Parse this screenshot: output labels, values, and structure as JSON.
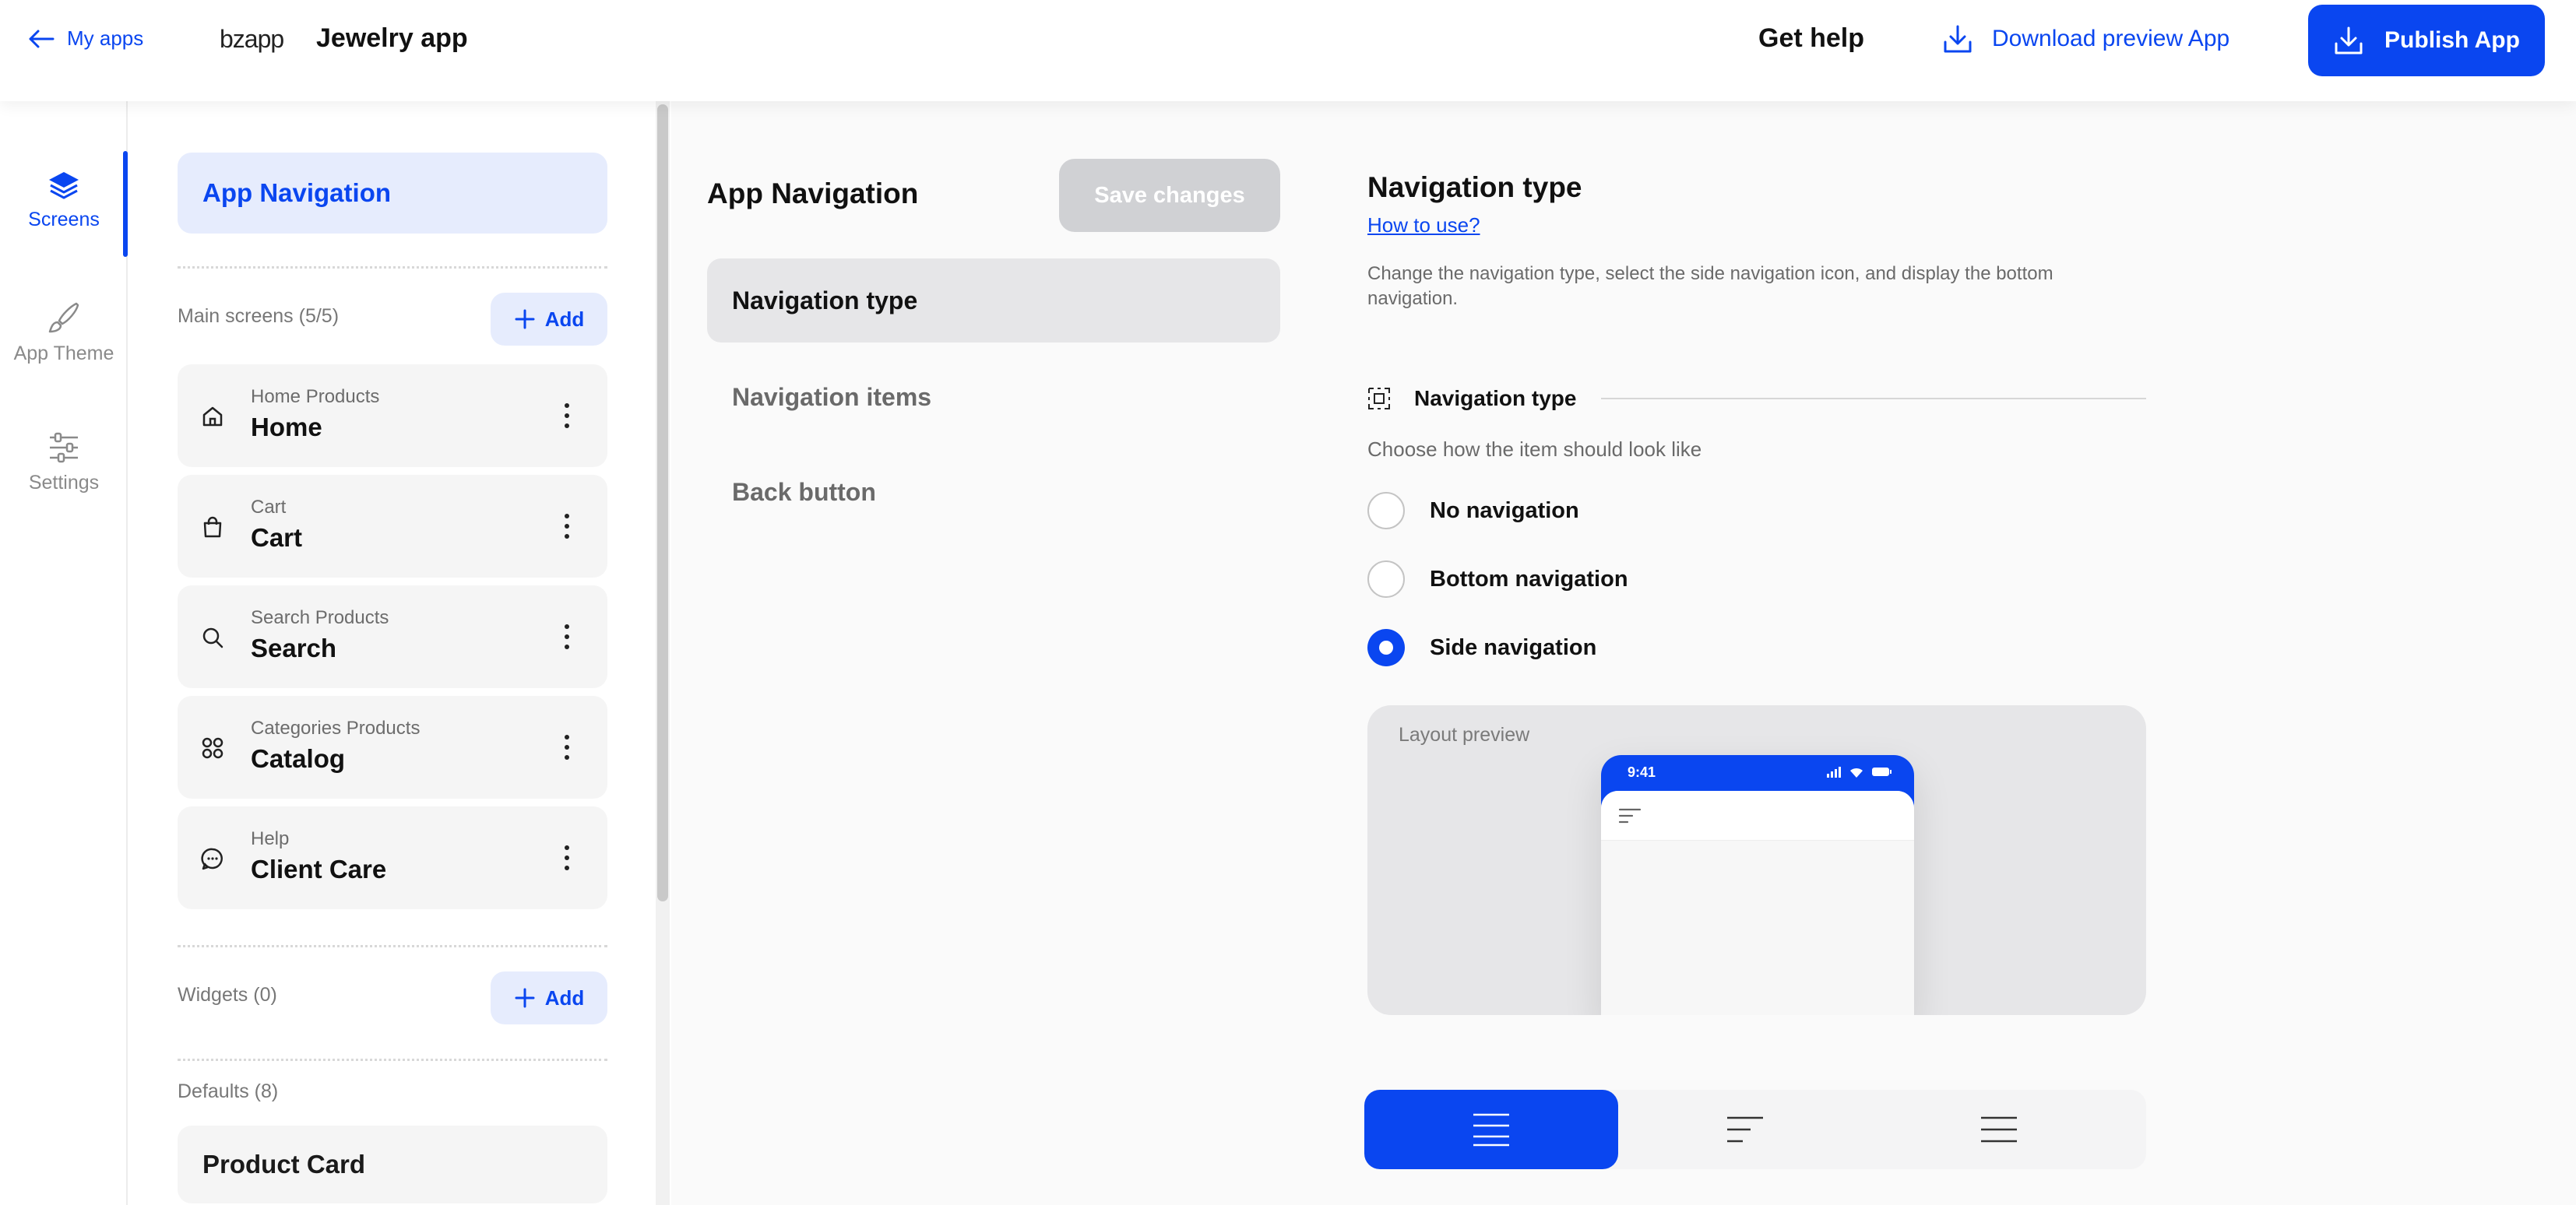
{
  "topbar": {
    "back_label": "My apps",
    "logo": "bzapp",
    "app_name": "Jewelry app",
    "get_help": "Get help",
    "download_label": "Download preview App",
    "publish_label": "Publish App"
  },
  "rail": {
    "items": [
      {
        "label": "Screens",
        "icon": "layers-icon",
        "active": true
      },
      {
        "label": "App Theme",
        "icon": "brush-icon",
        "active": false
      },
      {
        "label": "Settings",
        "icon": "sliders-icon",
        "active": false
      }
    ]
  },
  "screens_panel": {
    "app_navigation": "App Navigation",
    "main_screens_label": "Main screens (5/5)",
    "add_label": "Add",
    "items": [
      {
        "subtitle": "Home Products",
        "title": "Home",
        "icon": "home-icon"
      },
      {
        "subtitle": "Cart",
        "title": "Cart",
        "icon": "bag-icon"
      },
      {
        "subtitle": "Search Products",
        "title": "Search",
        "icon": "search-icon"
      },
      {
        "subtitle": "Categories Products",
        "title": "Catalog",
        "icon": "grid-icon"
      },
      {
        "subtitle": "Help",
        "title": "Client Care",
        "icon": "chat-icon"
      }
    ],
    "widgets_label": "Widgets (0)",
    "defaults_label": "Defaults (8)",
    "product_card": "Product Card"
  },
  "middle": {
    "title": "App Navigation",
    "save_label": "Save changes",
    "menu": [
      "Navigation type",
      "Navigation items",
      "Back button"
    ]
  },
  "right": {
    "title": "Navigation type",
    "link": "How to use?",
    "description": "Change the navigation type, select the side navigation icon, and display the bottom navigation.",
    "section_title": "Navigation type",
    "hint": "Choose how the item should look like",
    "options": [
      {
        "label": "No navigation",
        "selected": false
      },
      {
        "label": "Bottom navigation",
        "selected": false
      },
      {
        "label": "Side navigation",
        "selected": true
      }
    ],
    "preview_label": "Layout preview",
    "phone_time": "9:41",
    "layout_icons": [
      "menu-wide-icon",
      "menu-left-icon",
      "menu-lines-icon"
    ],
    "selected_layout": 0
  },
  "colors": {
    "accent": "#0a46f0",
    "accent_light": "#e6ecfd",
    "disabled": "#d0d1d4"
  }
}
